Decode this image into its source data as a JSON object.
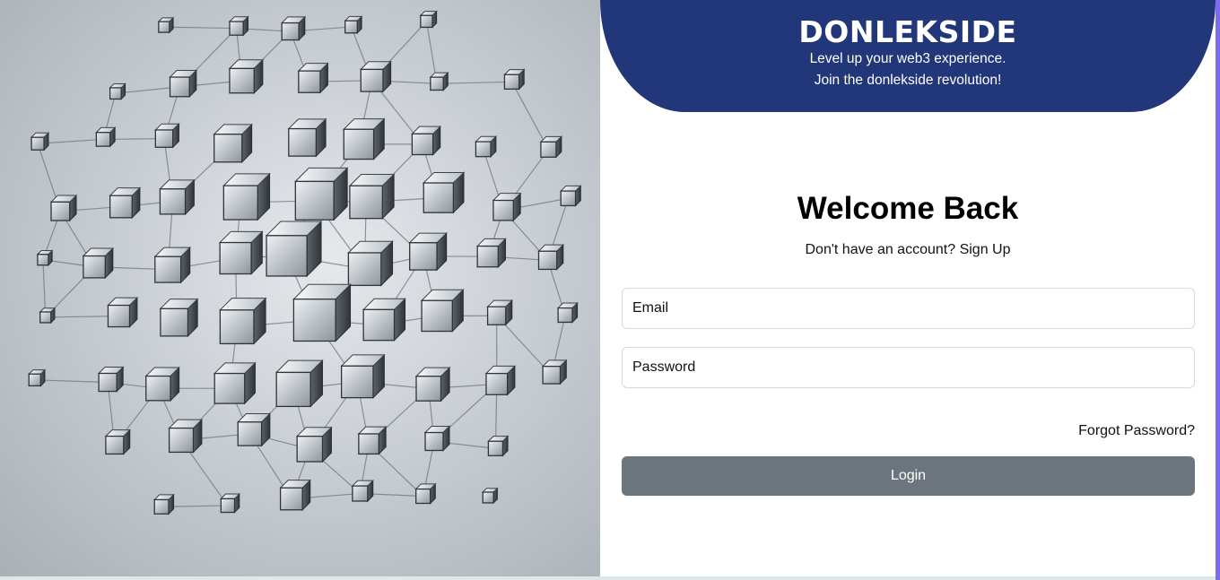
{
  "banner": {
    "brand": "DONLEKSIDE",
    "tagline_line1": "Level up your web3 experience.",
    "tagline_line2": "Join the donlekside revolution!",
    "color": "#22367a"
  },
  "login": {
    "heading": "Welcome Back",
    "signup_prompt": "Don't have an account?",
    "signup_link": "Sign Up",
    "email_placeholder": "Email",
    "password_placeholder": "Password",
    "forgot_password": "Forgot Password?",
    "login_button": "Login",
    "button_color": "#6c757d"
  },
  "hero_image": {
    "icon": "blockchain-cubes-illustration"
  }
}
